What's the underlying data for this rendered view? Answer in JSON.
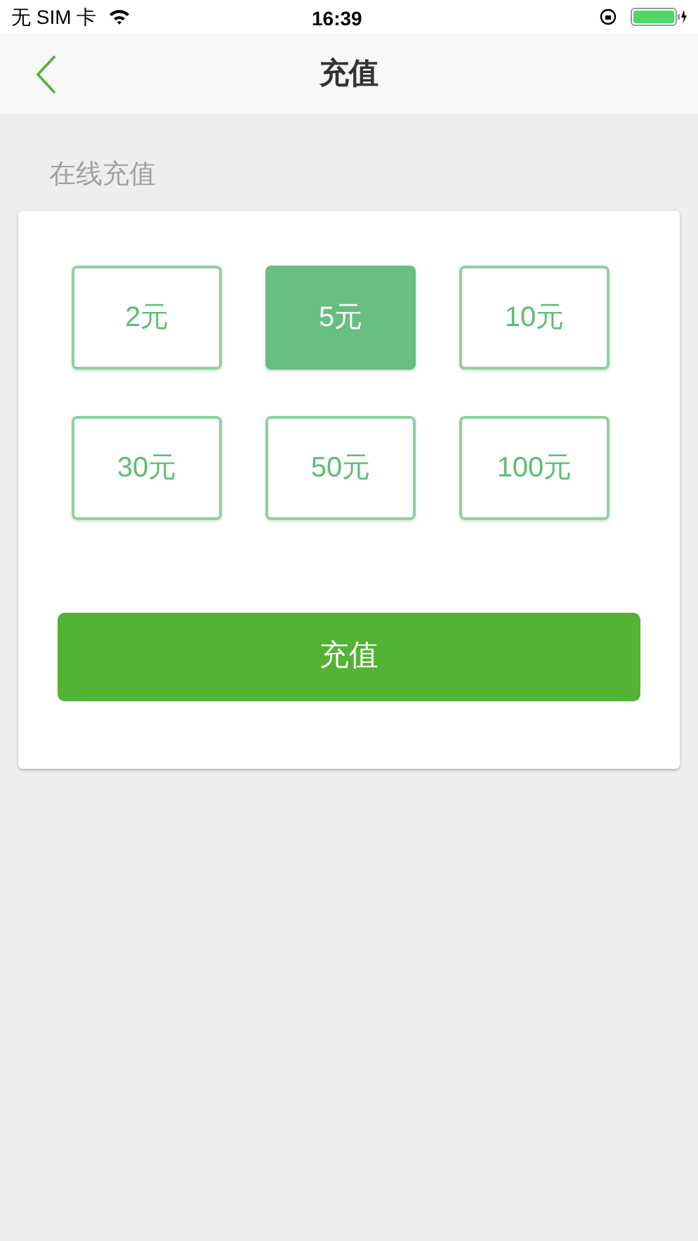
{
  "status_bar": {
    "carrier": "无 SIM 卡",
    "time": "16:39"
  },
  "nav": {
    "title": "充值"
  },
  "section_title": "在线充值",
  "options": [
    {
      "label": "2元",
      "selected": false
    },
    {
      "label": "5元",
      "selected": true
    },
    {
      "label": "10元",
      "selected": false
    },
    {
      "label": "30元",
      "selected": false
    },
    {
      "label": "50元",
      "selected": false
    },
    {
      "label": "100元",
      "selected": false
    }
  ],
  "submit": "充值"
}
